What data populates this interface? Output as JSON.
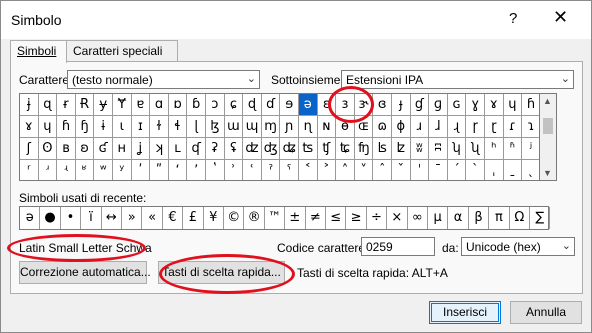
{
  "window": {
    "title": "Simbolo",
    "help_glyph": "?",
    "close_glyph": "✕"
  },
  "tabs": [
    {
      "label": "Simboli",
      "active": true
    },
    {
      "label": "Caratteri speciali",
      "active": false
    }
  ],
  "font_field": {
    "label": "Carattere:",
    "value": "(testo normale)"
  },
  "subset_field": {
    "label": "Sottoinsieme:",
    "value": "Estensioni IPA"
  },
  "symbol_grid": {
    "selected": "ə",
    "rows": [
      [
        "ɉ",
        "ɋ",
        "ɍ",
        "Ɍ",
        "ɏ",
        "Ɏ",
        "ɐ",
        "ɑ",
        "ɒ",
        "ɓ",
        "ɔ",
        "ɕ",
        "ɖ",
        "ɗ",
        "ɘ",
        "ə",
        "ɛ",
        "ɜ",
        "ɝ",
        "ɞ",
        "ɟ",
        "ɠ",
        "ɡ",
        "ɢ",
        "ɣ",
        "ɤ",
        "ɥ",
        "ɦ"
      ],
      [
        "ɤ",
        "ɥ",
        "ɦ",
        "ɧ",
        "ɨ",
        "ɩ",
        "ɪ",
        "ɫ",
        "ɬ",
        "ɭ",
        "ɮ",
        "ɯ",
        "ɰ",
        "ɱ",
        "ɲ",
        "ɳ",
        "ɴ",
        "ɵ",
        "ɶ",
        "ɷ",
        "ɸ",
        "ɹ",
        "ɺ",
        "ɻ",
        "ɼ",
        "ɽ",
        "ɾ",
        "ɿ"
      ],
      [
        "ʃ",
        "ʘ",
        "ʙ",
        "ʚ",
        "ʛ",
        "ʜ",
        "ʝ",
        "ʞ",
        "ʟ",
        "ʠ",
        "ʡ",
        "ʢ",
        "ʣ",
        "ʤ",
        "ʥ",
        "ʦ",
        "ʧ",
        "ʨ",
        "ʩ",
        "ʪ",
        "ʫ",
        "ʬ",
        "ʭ",
        "ʮ",
        "ʯ",
        "ʰ",
        "ʱ",
        "ʲ"
      ],
      [
        "ʳ",
        "ʴ",
        "ʵ",
        "ʶ",
        "ʷ",
        "ʸ",
        "ʹ",
        "ʺ",
        "ʻ",
        "ʼ",
        "ʽ",
        "ʾ",
        "ʿ",
        "ˀ",
        "ˁ",
        "˂",
        "˃",
        "˄",
        "˅",
        "ˆ",
        "ˇ",
        "ˈ",
        "ˉ",
        "ˊ",
        "ˋ",
        "ˌ",
        "ˍ",
        "ˎ"
      ]
    ]
  },
  "recent_label": "Simboli usati di recente:",
  "recent_symbols": [
    "ə",
    "●",
    "•",
    "ï",
    "↔",
    "»",
    "«",
    "€",
    "£",
    "¥",
    "©",
    "®",
    "™",
    "±",
    "≠",
    "≤",
    "≥",
    "÷",
    "×",
    "∞",
    "µ",
    "α",
    "β",
    "π",
    "Ω",
    "∑"
  ],
  "char_name": "Latin Small Letter Schwa",
  "code_field": {
    "label": "Codice carattere:",
    "value": "0259"
  },
  "from_field": {
    "label": "da:",
    "value": "Unicode (hex)"
  },
  "autocorrect_button": "Correzione automatica...",
  "shortcut_button": "Tasti di scelta rapida...",
  "shortcut_text": "Tasti di scelta rapida: ALT+A",
  "insert_button": "Inserisci",
  "cancel_button": "Annulla",
  "colors": {
    "selection": "#0a64c8",
    "annotation": "#e0101e"
  }
}
